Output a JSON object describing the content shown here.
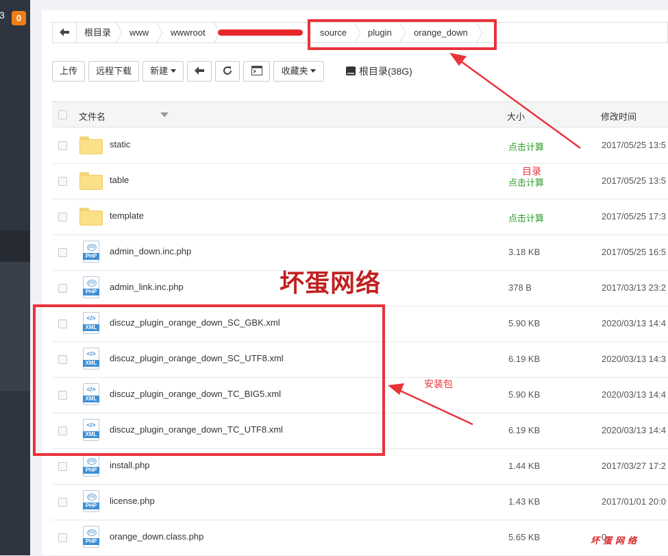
{
  "sidebar": {
    "corner_glyph": "3",
    "notification_count": "0"
  },
  "breadcrumb": {
    "items": [
      "根目录",
      "www",
      "wwwroot",
      "source",
      "plugin",
      "orange_down"
    ]
  },
  "toolbar": {
    "upload_label": "上传",
    "remote_download_label": "远程下载",
    "new_label": "新建",
    "favorites_label": "收藏夹",
    "disk_label": "根目录(38G)"
  },
  "table": {
    "columns": {
      "name": "文件名",
      "size": "大小",
      "modified": "修改时间"
    },
    "rows": [
      {
        "name": "static",
        "type": "folder",
        "size": "点击计算",
        "modified": "2017/05/25 13:5"
      },
      {
        "name": "table",
        "type": "folder",
        "size": "点击计算",
        "modified": "2017/05/25 13:5"
      },
      {
        "name": "template",
        "type": "folder",
        "size": "点击计算",
        "modified": "2017/05/25 17:3"
      },
      {
        "name": "admin_down.inc.php",
        "type": "php",
        "size": "3.18 KB",
        "modified": "2017/05/25 16:5"
      },
      {
        "name": "admin_link.inc.php",
        "type": "php",
        "size": "378 B",
        "modified": "2017/03/13 23:2"
      },
      {
        "name": "discuz_plugin_orange_down_SC_GBK.xml",
        "type": "xml",
        "size": "5.90 KB",
        "modified": "2020/03/13 14:4"
      },
      {
        "name": "discuz_plugin_orange_down_SC_UTF8.xml",
        "type": "xml",
        "size": "6.19 KB",
        "modified": "2020/03/13 14:3"
      },
      {
        "name": "discuz_plugin_orange_down_TC_BIG5.xml",
        "type": "xml",
        "size": "5.90 KB",
        "modified": "2020/03/13 14:4"
      },
      {
        "name": "discuz_plugin_orange_down_TC_UTF8.xml",
        "type": "xml",
        "size": "6.19 KB",
        "modified": "2020/03/13 14:4"
      },
      {
        "name": "install.php",
        "type": "php",
        "size": "1.44 KB",
        "modified": "2017/03/27 17:2"
      },
      {
        "name": "license.php",
        "type": "php",
        "size": "1.43 KB",
        "modified": "2017/01/01 20:0"
      },
      {
        "name": "orange_down.class.php",
        "type": "php",
        "size": "5.65 KB",
        "modified": "0"
      }
    ]
  },
  "icons": {
    "php_label": "PHP",
    "xml_label": "XML",
    "php_ring": "php",
    "xml_glyph": "</>"
  },
  "annotations": {
    "directory_label": "目录",
    "package_label": "安装包",
    "watermark_big": "坏蛋网络",
    "watermark_small": "坏蛋网络"
  },
  "colors": {
    "annotation_red": "#e8333a",
    "badge_orange": "#f07f1a",
    "calc_green": "#2a9d2a",
    "file_icon_blue": "#3d8fd6"
  }
}
